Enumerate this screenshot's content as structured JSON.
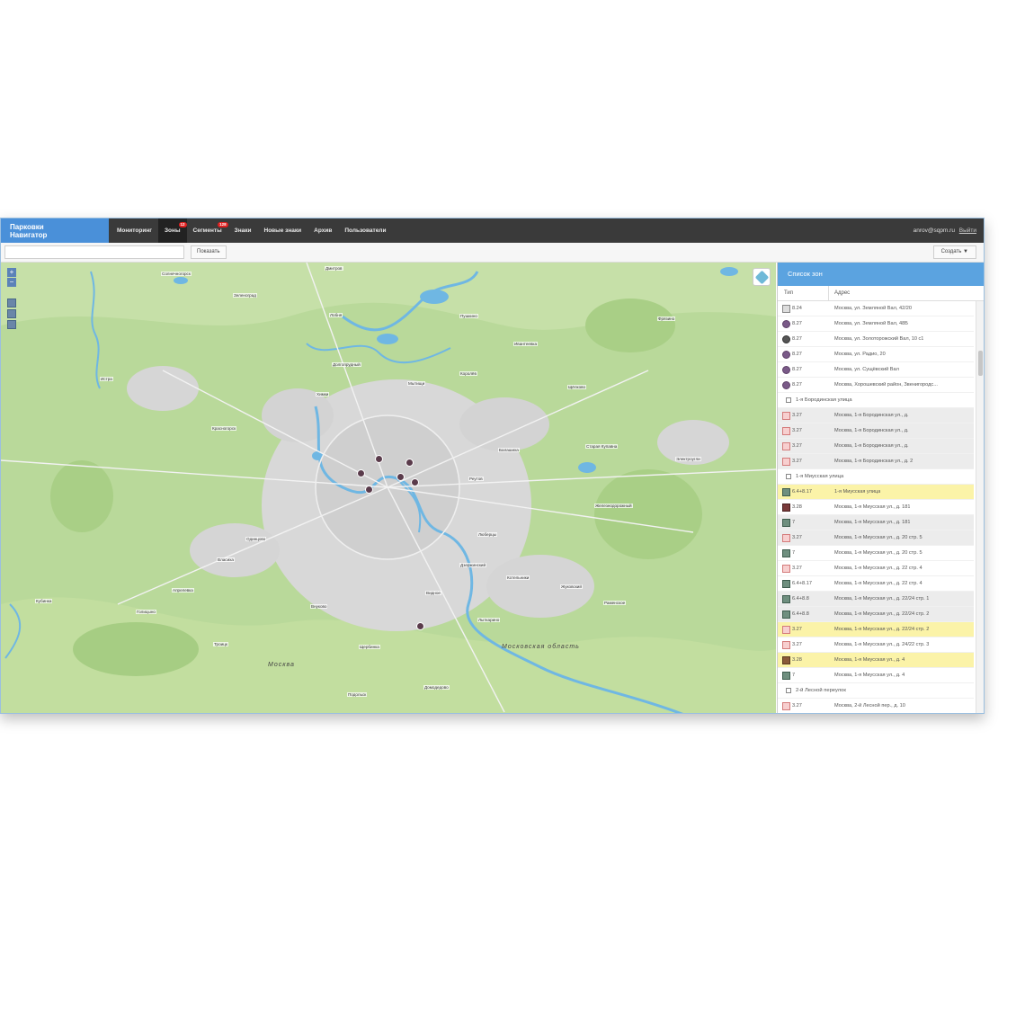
{
  "app": {
    "brand_line1": "Парковки",
    "brand_line2": "Навигатор"
  },
  "nav": [
    {
      "label": "Мониторинг",
      "badge": ""
    },
    {
      "label": "Зоны",
      "badge": "12"
    },
    {
      "label": "Сегменты",
      "badge": "128"
    },
    {
      "label": "Знаки",
      "badge": ""
    },
    {
      "label": "Новые знаки",
      "badge": ""
    },
    {
      "label": "Архив",
      "badge": ""
    },
    {
      "label": "Пользователи",
      "badge": ""
    }
  ],
  "user": {
    "email": "anrov@sqpm.ru",
    "logout": "Выйти"
  },
  "toolbar": {
    "search_placeholder": "",
    "show_label": "Показать",
    "create_label": "Создать ▼"
  },
  "map": {
    "region_label": "Московская область",
    "city_label": "Москва",
    "place_labels": [
      "Истра",
      "Зеленоград",
      "Долгопрудный",
      "Мытищи",
      "Королёв",
      "Щёлково",
      "Балашиха",
      "Реутов",
      "Красногорск",
      "Химки",
      "Одинцово",
      "Люберцы",
      "Дзержинский",
      "Лыткарино",
      "Видное",
      "Домодедово",
      "Подольск",
      "Щербинка",
      "Троицк",
      "Апрелевка",
      "Внуково",
      "Жуковский",
      "Раменское",
      "Пушкино",
      "Ивантеевка",
      "Фрязино",
      "Лобня",
      "Солнечногорск",
      "Дмитров",
      "Кубинка",
      "Голицыно",
      "Власиха",
      "Электроугли",
      "Железнодорожный",
      "Старая Купавна",
      "Котельники",
      "Дзержинский",
      "Москва",
      "Московская область"
    ]
  },
  "sidebar": {
    "title": "Список зон",
    "col_type": "Тип",
    "col_address": "Адрес",
    "rows": [
      {
        "kind": "row",
        "style": "",
        "icon": "pin",
        "type": "8.24",
        "address": "Москва, ул. Земляной Вал, 42/20"
      },
      {
        "kind": "row",
        "style": "",
        "icon": "circ",
        "type": "8.27",
        "address": "Москва, ул. Земляной Вал, 48Б"
      },
      {
        "kind": "row",
        "style": "",
        "icon": "grey",
        "type": "8.27",
        "address": "Москва, ул. Золоторожский Вал, 10 с1"
      },
      {
        "kind": "row",
        "style": "",
        "icon": "circ",
        "type": "8.27",
        "address": "Москва, ул. Радио, 20"
      },
      {
        "kind": "row",
        "style": "",
        "icon": "circ",
        "type": "8.27",
        "address": "Москва, ул. Сущёвский Вал"
      },
      {
        "kind": "row",
        "style": "",
        "icon": "circ",
        "type": "8.27",
        "address": "Москва, Хорошевский район, Звенигородс..."
      },
      {
        "kind": "group",
        "label": "1-я Бородинская улица"
      },
      {
        "kind": "row",
        "style": "alt",
        "icon": "sq-pink",
        "type": "3.27",
        "address": "Москва, 1-я Бородинская ул., д."
      },
      {
        "kind": "row",
        "style": "alt",
        "icon": "sq-pink",
        "type": "3.27",
        "address": "Москва, 1-я Бородинская ул., д."
      },
      {
        "kind": "row",
        "style": "alt",
        "icon": "sq-pink",
        "type": "3.27",
        "address": "Москва, 1-я Бородинская ул., д."
      },
      {
        "kind": "row",
        "style": "alt",
        "icon": "sq-pink",
        "type": "3.27",
        "address": "Москва, 1-я Бородинская ул., д. 2"
      },
      {
        "kind": "group",
        "label": "1-я Миусская улица"
      },
      {
        "kind": "row",
        "style": "hl",
        "icon": "sq-green",
        "type": "6.4+8.17",
        "address": "1-я Миусская улица"
      },
      {
        "kind": "row",
        "style": "",
        "icon": "sq-dark",
        "type": "3.28",
        "address": "Москва, 1-я Миусская ул., д. 181"
      },
      {
        "kind": "row",
        "style": "alt",
        "icon": "sq-green",
        "type": "7",
        "address": "Москва, 1-я Миусская ул., д. 181"
      },
      {
        "kind": "row",
        "style": "alt",
        "icon": "sq-pink",
        "type": "3.27",
        "address": "Москва, 1-я Миусская ул., д. 20 стр. 5"
      },
      {
        "kind": "row",
        "style": "",
        "icon": "sq-green",
        "type": "7",
        "address": "Москва, 1-я Миусская ул., д. 20 стр. 5"
      },
      {
        "kind": "row",
        "style": "",
        "icon": "sq-pink",
        "type": "3.27",
        "address": "Москва, 1-я Миусская ул., д. 22 стр. 4"
      },
      {
        "kind": "row",
        "style": "",
        "icon": "sq-green",
        "type": "6.4+8.17",
        "address": "Москва, 1-я Миусская ул., д. 22 стр. 4"
      },
      {
        "kind": "row",
        "style": "alt",
        "icon": "sq-green",
        "type": "6.4+8.8",
        "address": "Москва, 1-я Миусская ул., д. 22/24 стр. 1"
      },
      {
        "kind": "row",
        "style": "alt",
        "icon": "sq-green",
        "type": "6.4+8.8",
        "address": "Москва, 1-я Миусская ул., д. 22/24 стр. 2"
      },
      {
        "kind": "row",
        "style": "hl",
        "icon": "sq-pink",
        "type": "3.27",
        "address": "Москва, 1-я Миусская ул., д. 22/24 стр. 2"
      },
      {
        "kind": "row",
        "style": "",
        "icon": "sq-pink",
        "type": "3.27",
        "address": "Москва, 1-я Миусская ул., д. 24/22 стр. 3"
      },
      {
        "kind": "row",
        "style": "hl",
        "icon": "sq-brown",
        "type": "3.28",
        "address": "Москва, 1-я Миусская ул., д. 4"
      },
      {
        "kind": "row",
        "style": "",
        "icon": "sq-green",
        "type": "7",
        "address": "Москва, 1-я Миусская ул., д. 4"
      },
      {
        "kind": "group",
        "label": "2-й Лесной переулок"
      },
      {
        "kind": "row",
        "style": "",
        "icon": "sq-pink",
        "type": "3.27",
        "address": "Москва, 2-й Лесной пер., д. 10"
      }
    ]
  }
}
